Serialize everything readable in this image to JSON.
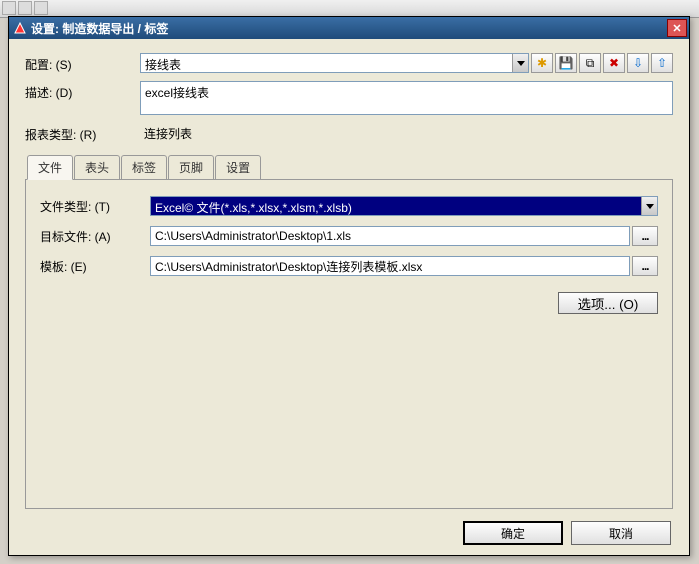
{
  "dialog": {
    "title": "设置: 制造数据导出 / 标签",
    "close": "✕"
  },
  "fields": {
    "config_label": "配置:  (S)",
    "config_value": "接线表",
    "desc_label": "描述:  (D)",
    "desc_value": "excel接线表",
    "report_type_label": "报表类型:  (R)",
    "report_type_value": "连接列表"
  },
  "toolbar_icons": {
    "new": "✱",
    "save": "💾",
    "copy": "⧉",
    "delete": "✖",
    "import": "⇩",
    "export": "⇧"
  },
  "tabs": [
    "文件",
    "表头",
    "标签",
    "页脚",
    "设置"
  ],
  "active_tab": 0,
  "file_tab": {
    "filetype_label": "文件类型:  (T)",
    "filetype_value": "Excel© 文件(*.xls,*.xlsx,*.xlsm,*.xlsb)",
    "target_label": "目标文件:  (A)",
    "target_value": "C:\\Users\\Administrator\\Desktop\\1.xls",
    "template_label": "模板:  (E)",
    "template_value": "C:\\Users\\Administrator\\Desktop\\连接列表模板.xlsx",
    "options_label": "选项...  (O)",
    "browse": "..."
  },
  "buttons": {
    "ok": "确定",
    "cancel": "取消"
  }
}
